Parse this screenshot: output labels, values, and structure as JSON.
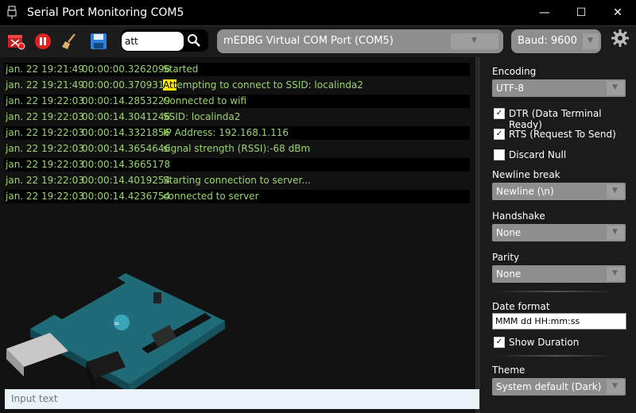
{
  "window": {
    "title": "Serial Port Monitoring COM5",
    "minimize": "—",
    "maximize": "☐",
    "close": "✕"
  },
  "toolbar": {
    "search_value": "att",
    "port": "mEDBG Virtual COM Port (COM5)",
    "baud": "Baud: 9600"
  },
  "log": [
    {
      "date": "jan. 22 19:21:49",
      "duration": "00:00:00.3262096",
      "message": "Started"
    },
    {
      "date": "jan. 22 19:21:49",
      "duration": "00:00:00.3709319",
      "highlight": "Att",
      "message": "empting to connect to SSID: localinda2"
    },
    {
      "date": "jan. 22 19:22:03",
      "duration": "00:00:14.2853229",
      "message": "Connected to wifi"
    },
    {
      "date": "jan. 22 19:22:03",
      "duration": "00:00:14.3041246",
      "message": "SSID: localinda2"
    },
    {
      "date": "jan. 22 19:22:03",
      "duration": "00:00:14.3321856",
      "message": "IP Address: 192.168.1.116"
    },
    {
      "date": "jan. 22 19:22:03",
      "duration": "00:00:14.3654646",
      "message": "signal strength (RSSI):-68 dBm"
    },
    {
      "date": "jan. 22 19:22:03",
      "duration": "00:00:14.3665178",
      "message": ""
    },
    {
      "date": "jan. 22 19:22:03",
      "duration": "00:00:14.4019254",
      "message": "Starting connection to server..."
    },
    {
      "date": "jan. 22 19:22:03",
      "duration": "00:00:14.4236754",
      "message": "connected to server"
    }
  ],
  "input": {
    "placeholder": "Input text"
  },
  "settings": {
    "encoding_label": "Encoding",
    "encoding_value": "UTF-8",
    "dtr_label": "DTR (Data Terminal Ready)",
    "rts_label": "RTS (Request To Send)",
    "discard_null_label": "Discard Null",
    "newline_label": "Newline break",
    "newline_value": "Newline (\\n)",
    "handshake_label": "Handshake",
    "handshake_value": "None",
    "parity_label": "Parity",
    "parity_value": "None",
    "date_format_label": "Date format",
    "date_format_value": "MMM dd HH:mm:ss",
    "show_duration_label": "Show Duration",
    "theme_label": "Theme",
    "theme_value": "System default (Dark)",
    "checkmark": "✓"
  },
  "colors": {
    "log_text": "#9bd46e",
    "highlight": "#ffea00",
    "stop_red": "#e22222"
  }
}
